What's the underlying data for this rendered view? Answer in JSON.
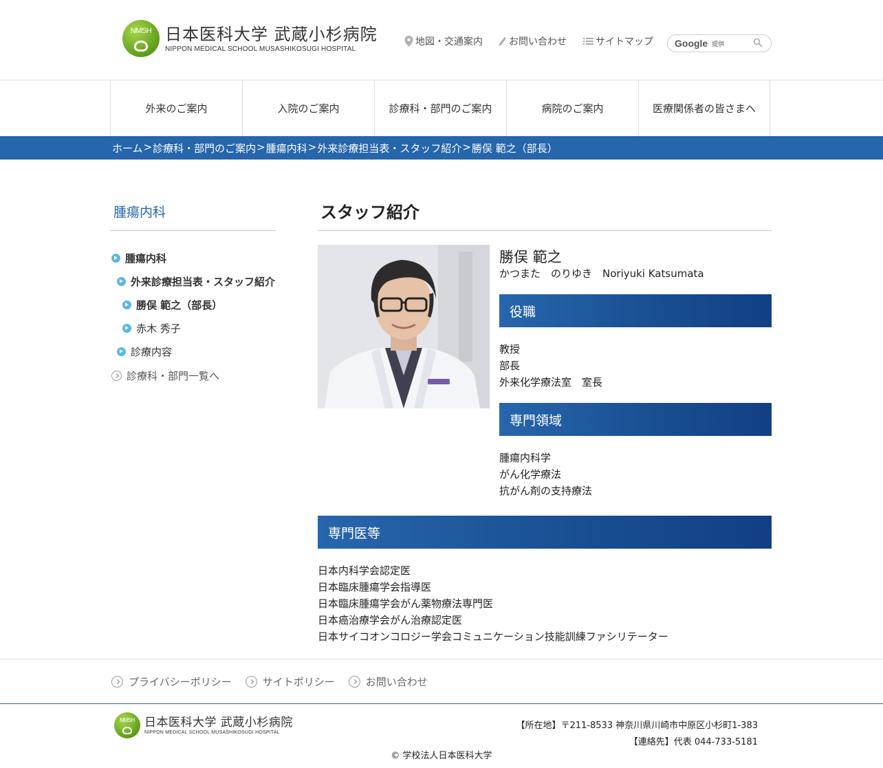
{
  "header": {
    "logo_mark": "NMSH",
    "logo_jp": "日本医科大学 武蔵小杉病院",
    "logo_en": "NIPPON MEDICAL SCHOOL MUSASHIKOSUGI HOSPITAL",
    "util_links": {
      "map": "地図・交通案内",
      "contact": "お問い合わせ",
      "sitemap": "サイトマップ"
    },
    "search": {
      "brand": "Google",
      "provided": "提供",
      "value": ""
    }
  },
  "gnav": [
    "外来のご案内",
    "入院のご案内",
    "診療科・部門のご案内",
    "病院のご案内",
    "医療関係者の皆さまへ"
  ],
  "breadcrumb": {
    "items": [
      "ホーム",
      "診療科・部門のご案内",
      "腫瘍内科",
      "外来診療担当表・スタッフ紹介",
      "勝俣 範之（部長）"
    ],
    "separator": ">"
  },
  "sidenav": {
    "title": "腫瘍内科",
    "items": [
      {
        "label": "腫瘍内科",
        "level": 1,
        "bold": true
      },
      {
        "label": "外来診療担当表・スタッフ紹介",
        "level": 2,
        "bold": true
      },
      {
        "label": "勝俣 範之（部長）",
        "level": 3,
        "bold": true
      },
      {
        "label": "赤木 秀子",
        "level": 3,
        "bold": false
      },
      {
        "label": "診療内容",
        "level": 2,
        "bold": false
      }
    ],
    "back_link": "診療科・部門一覧へ"
  },
  "main": {
    "title": "スタッフ紹介",
    "doctor": {
      "name": "勝俣 範之",
      "kana": "かつまた　のりゆき　Noriyuki Katsumata"
    },
    "sections": {
      "position": {
        "heading": "役職",
        "items": [
          "教授",
          "部長",
          "外来化学療法室　室長"
        ]
      },
      "specialty": {
        "heading": "専門領域",
        "items": [
          "腫瘍内科学",
          "がん化学療法",
          "抗がん剤の支持療法"
        ]
      },
      "certifications": {
        "heading": "専門医等",
        "items": [
          "日本内科学会認定医",
          "日本臨床腫瘍学会指導医",
          "日本臨床腫瘍学会がん薬物療法専門医",
          "日本癌治療学会がん治療認定医",
          "日本サイコオンコロジー学会コミュニケーション技能訓練ファシリテーター"
        ]
      }
    }
  },
  "footer": {
    "links": [
      "プライバシーポリシー",
      "サイトポリシー",
      "お問い合わせ"
    ],
    "logo_jp": "日本医科大学 武蔵小杉病院",
    "logo_en": "NIPPON MEDICAL SCHOOL MUSASHIKOSUGI HOSPITAL",
    "address": "【所在地】〒211-8533 神奈川県川崎市中原区小杉町1-383",
    "phone": "【連絡先】代表 044-733-5181",
    "copyright": "© 学校法人日本医科大学"
  },
  "colors": {
    "brand_blue": "#2566ac",
    "heading_bar_start": "#2766ad",
    "heading_bar_end": "#123f84",
    "bullet_blue": "#58b6e8",
    "logo_green": "#5f9e1c"
  },
  "icons": {
    "map": "map-pin-icon",
    "contact": "phone-icon",
    "sitemap": "list-icon",
    "search": "search-icon"
  }
}
